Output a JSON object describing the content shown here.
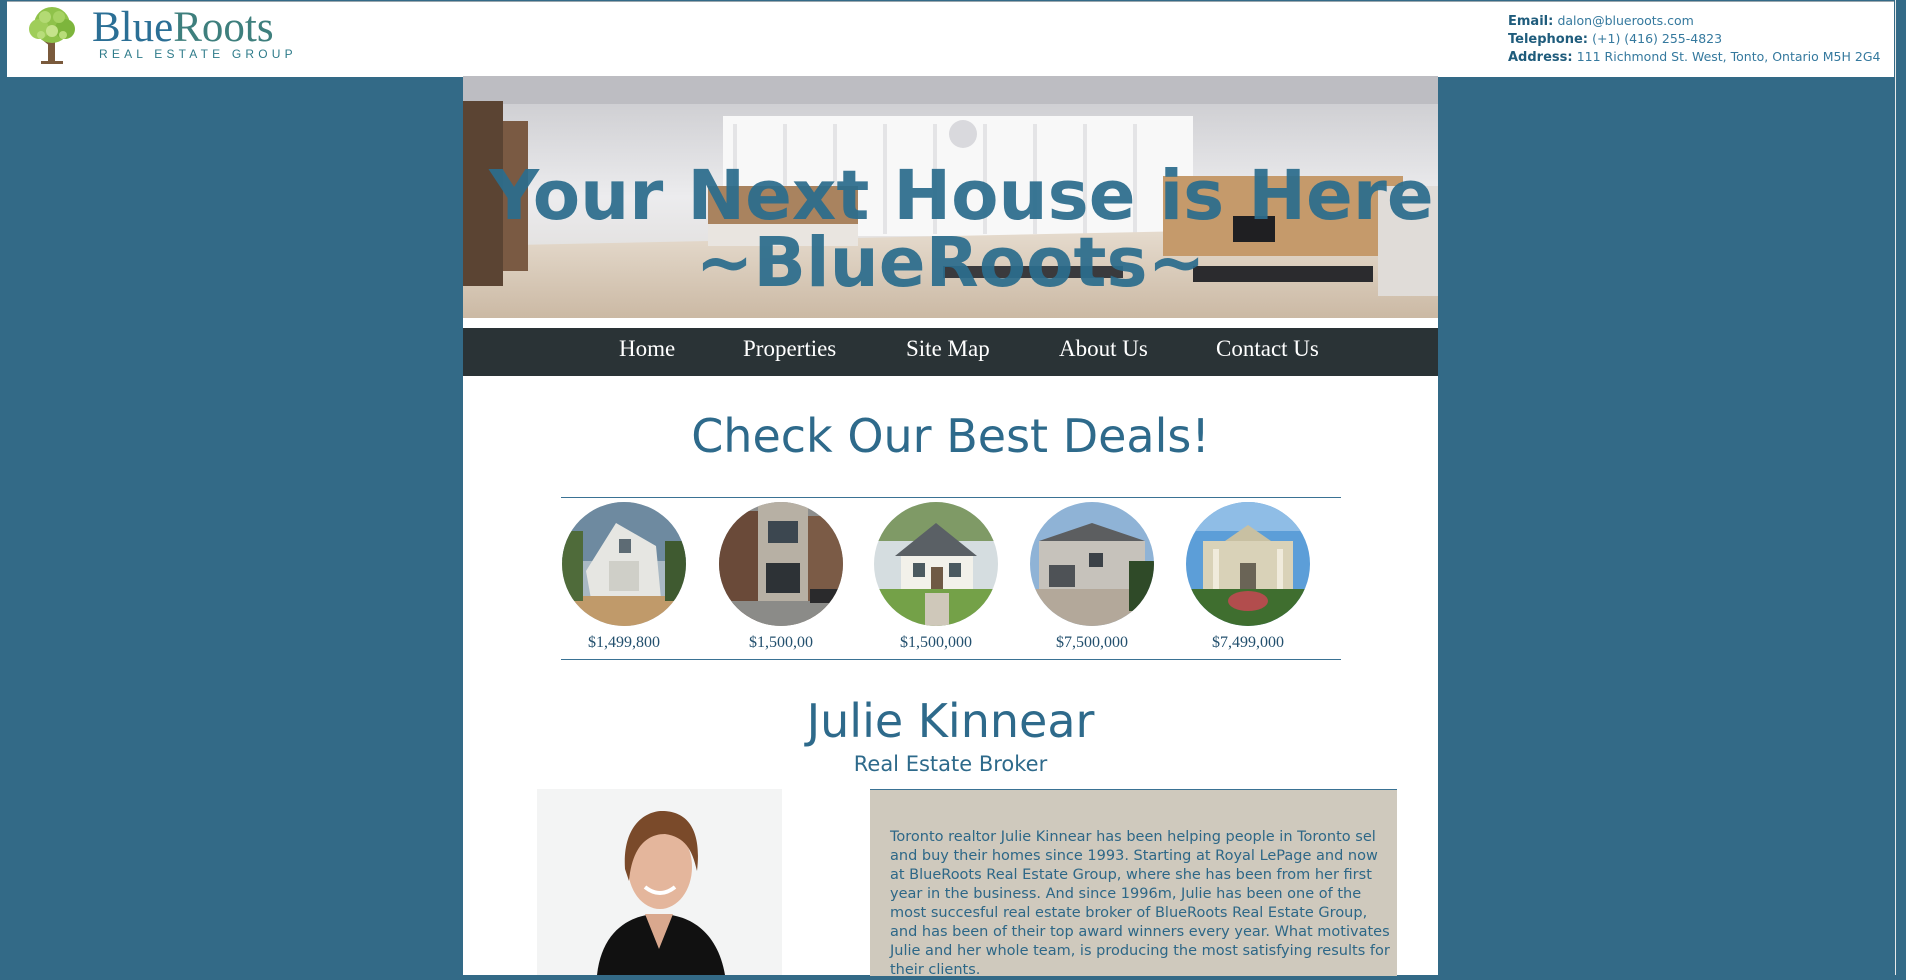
{
  "brand": {
    "name_part1": "Blue",
    "name_part2": "Roots",
    "tagline": "REAL ESTATE GROUP"
  },
  "contact": {
    "email_label": "Email:",
    "email": "dalon@blueroots.com",
    "telephone_label": "Telephone:",
    "telephone": "(+1) (416) 255-4823",
    "address_label": "Address:",
    "address": "111 Richmond St. West, Tonto, Ontario M5H 2G4"
  },
  "hero": {
    "line1": "Your Next House is Here.",
    "line2": "~BlueRoots~"
  },
  "nav": {
    "items": [
      "Home",
      "Properties",
      "Site Map",
      "About Us",
      "Contact Us"
    ]
  },
  "deals": {
    "title": "Check Our Best Deals!",
    "prices": [
      "$1,499,800",
      "$1,500,00",
      "$1,500,000",
      "$7,500,000",
      "$7,499,000"
    ]
  },
  "agent": {
    "name": "Julie Kinnear",
    "role": "Real Estate Broker",
    "bio": "Toronto realtor Julie Kinnear has been helping people in Toronto sel and buy their homes since 1993. Starting at Royal LePage and now at BlueRoots Real Estate Group, where she has been from her first year in the business. And since 1996m, Julie has been one of the most succesful real estate broker of BlueRoots Real Estate Group, and has been of their top award winners every year. What motivates Julie and her whole team, is producing the most satisfying results for their clients."
  },
  "colors": {
    "page_bg": "#336a87",
    "accent": "#2e6a8b",
    "nav_bg": "#2a3336",
    "bio_bg": "#cfc9bd"
  }
}
